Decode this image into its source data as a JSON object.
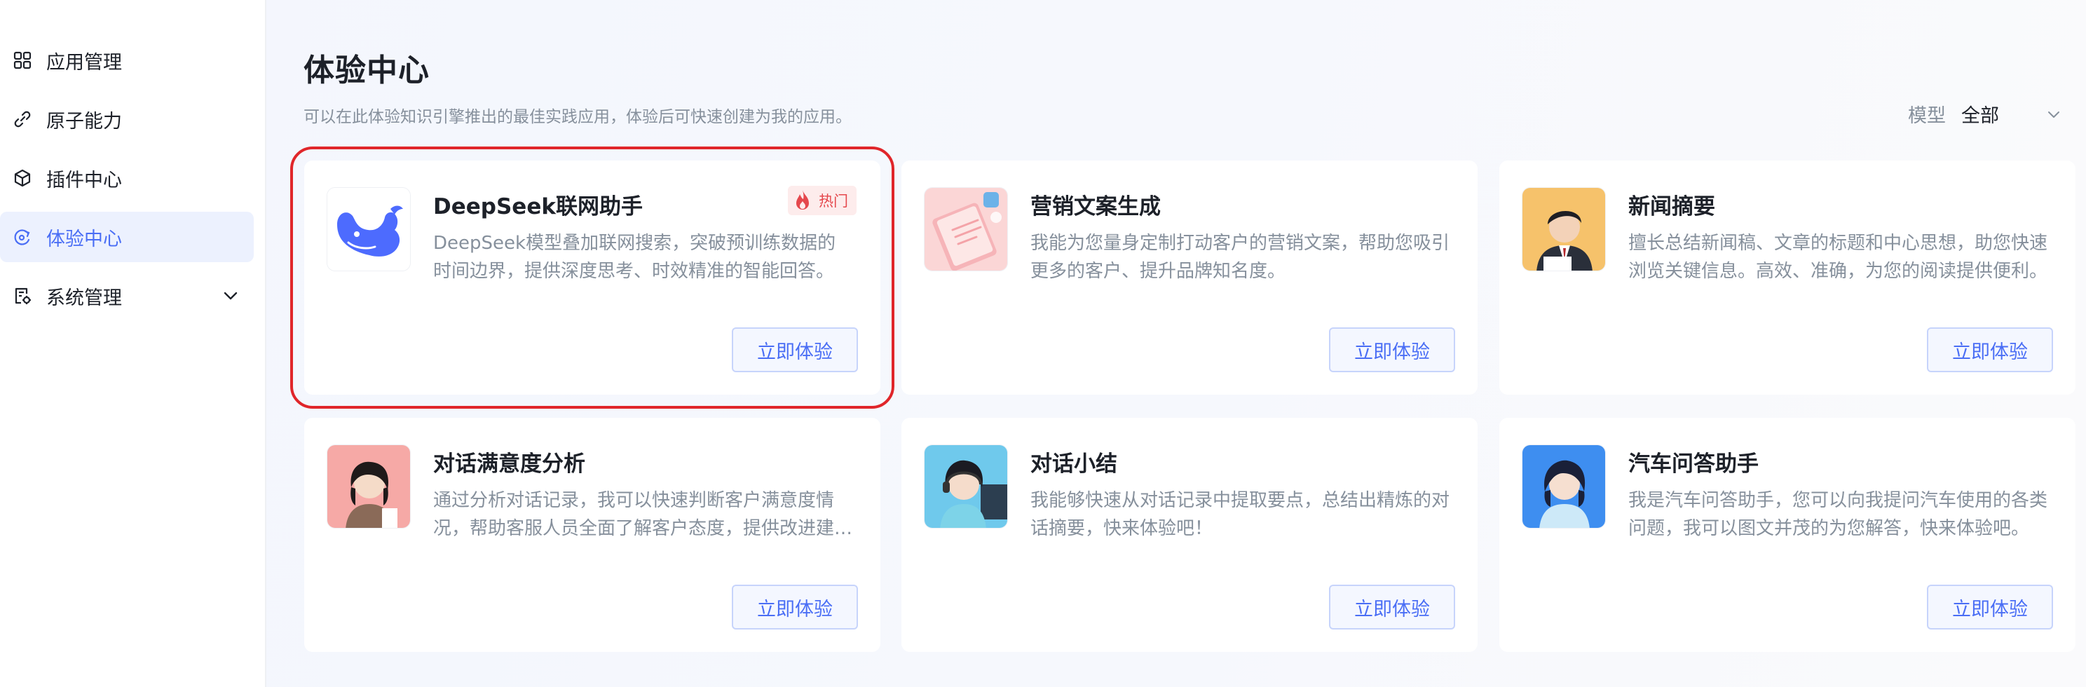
{
  "sidebar": {
    "items": [
      {
        "label": "应用管理"
      },
      {
        "label": "原子能力"
      },
      {
        "label": "插件中心"
      },
      {
        "label": "体验中心"
      },
      {
        "label": "系统管理"
      }
    ]
  },
  "header": {
    "title": "体验中心",
    "subtitle": "可以在此体验知识引擎推出的最佳实践应用，体验后可快速创建为我的应用。",
    "filter_label": "模型",
    "filter_value": "全部"
  },
  "colors": {
    "accent": "#4a6ef5",
    "highlight": "#e0262a",
    "hot_badge": "#e5484d"
  },
  "cards": [
    {
      "title": "DeepSeek联网助手",
      "description": "DeepSeek模型叠加联网搜索，突破预训练数据的时间边界，提供深度思考、时效精准的智能回答。",
      "badge": "热门",
      "button": "立即体验",
      "icon": "whale-logo-icon"
    },
    {
      "title": "营销文案生成",
      "description": "我能为您量身定制打动客户的营销文案，帮助您吸引更多的客户、提升品牌知名度。",
      "button": "立即体验",
      "icon": "notebook-illustration"
    },
    {
      "title": "新闻摘要",
      "description": "擅长总结新闻稿、文章的标题和中心思想，助您快速浏览关键信息。高效、准确，为您的阅读提供便利。",
      "button": "立即体验",
      "icon": "man-in-suit-avatar"
    },
    {
      "title": "对话满意度分析",
      "description": "通过分析对话记录，我可以快速判断客户满意度情况，帮助客服人员全面了解客户态度，提供改进建议。",
      "button": "立即体验",
      "icon": "woman-avatar"
    },
    {
      "title": "对话小结",
      "description": "我能够快速从对话记录中提取要点，总结出精炼的对话摘要，快来体验吧！",
      "button": "立即体验",
      "icon": "headset-girl-avatar"
    },
    {
      "title": "汽车问答助手",
      "description": "我是汽车问答助手，您可以向我提问汽车使用的各类问题，我可以图文并茂的为您解答，快来体验吧。",
      "button": "立即体验",
      "icon": "girl-avatar"
    }
  ]
}
